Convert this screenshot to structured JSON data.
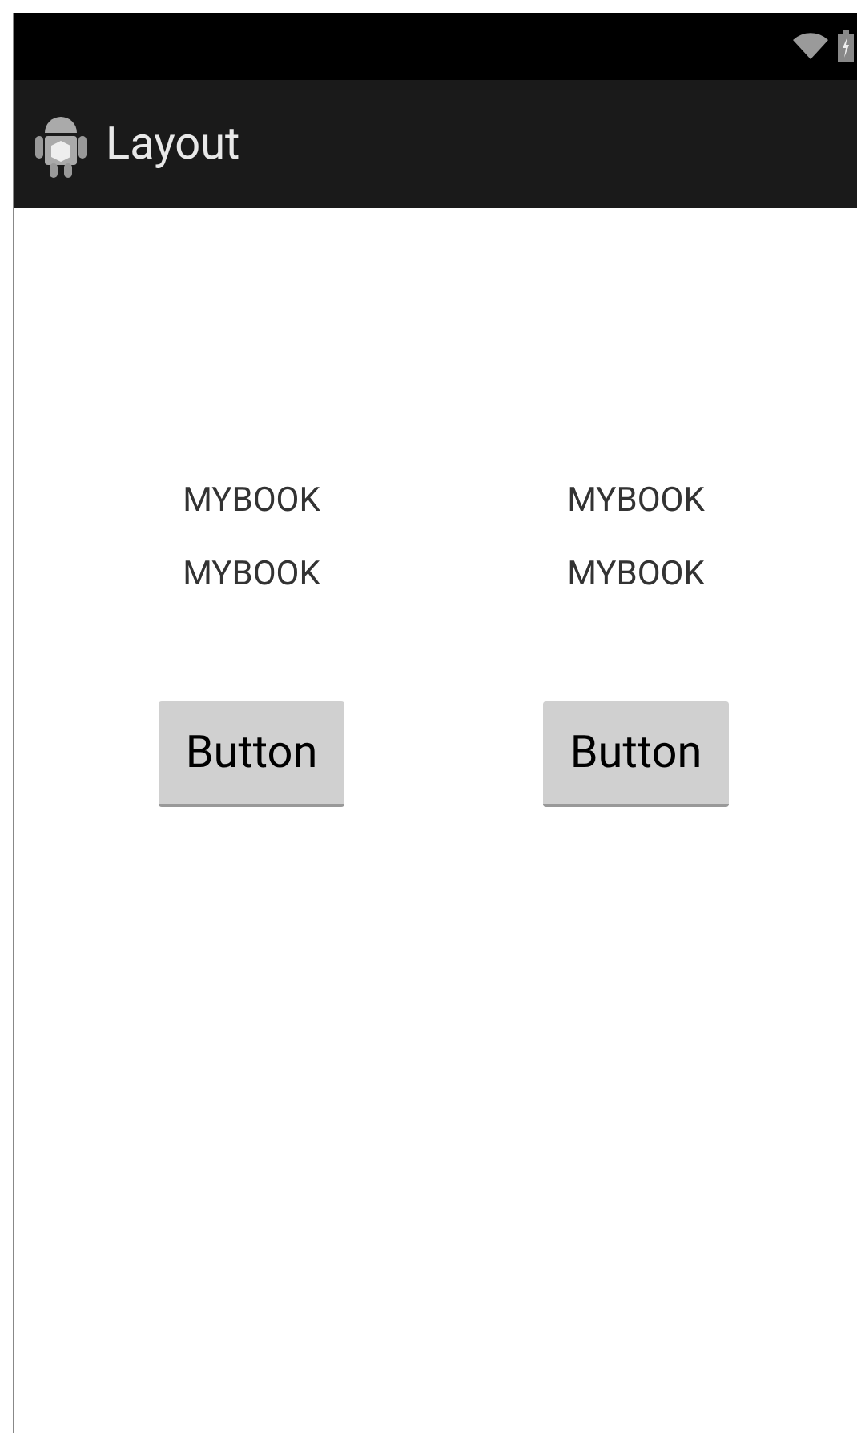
{
  "action_bar": {
    "title": "Layout"
  },
  "columns": [
    {
      "texts": [
        "MYBOOK",
        "MYBOOK"
      ],
      "button": "Button"
    },
    {
      "texts": [
        "MYBOOK",
        "MYBOOK"
      ],
      "button": "Button"
    }
  ]
}
